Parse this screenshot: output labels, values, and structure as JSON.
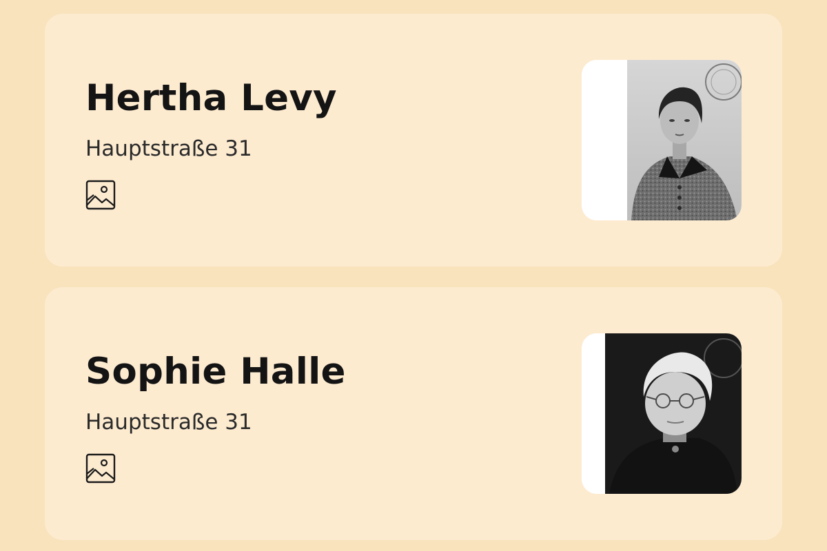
{
  "persons": [
    {
      "name": "Hertha Levy",
      "address": "Hauptstraße 31",
      "gallery_icon": "image-gallery-icon",
      "photo": "portrait-photo-hertha-levy"
    },
    {
      "name": "Sophie Halle",
      "address": "Hauptstraße 31",
      "gallery_icon": "image-gallery-icon",
      "photo": "portrait-photo-sophie-halle"
    }
  ],
  "colors": {
    "page_background": "#f9e3bd",
    "card_background": "#fdebd0",
    "text_primary": "#141414",
    "text_secondary": "#2a2a2a"
  }
}
